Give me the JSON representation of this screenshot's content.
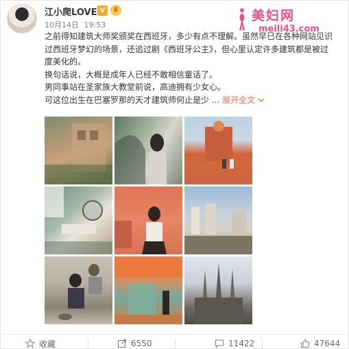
{
  "user": {
    "name": "江小爬LOVE",
    "vip_badge": "V",
    "crown_badge": "♛"
  },
  "post": {
    "date": "10月14日",
    "time": "19:53",
    "lines": [
      "之前得知建筑大师奖颁奖在西班牙，多少有点不理解。虽然早已在各种网站见识",
      "过西班牙梦幻的场景，还追过剧《西班牙公主》，但心里认定许多建筑都是被过",
      "度美化的。",
      "换句话说，大概是成年人已经不敢相信童话了。",
      "男同事站在圣家族大教堂前说，高迪拥有少女心。",
      "可这位出生在巴塞罗那的天才建筑师何止是少"
    ],
    "expand_label": "展开全文",
    "expand_icon": "chevron-down-icon"
  },
  "watermark": {
    "title": "美妇网",
    "url": "meili43.com"
  },
  "images": [
    {
      "name": "photo-1",
      "label": ""
    },
    {
      "name": "photo-2",
      "label": ""
    },
    {
      "name": "photo-3",
      "label": ""
    },
    {
      "name": "photo-4",
      "label": ""
    },
    {
      "name": "photo-5",
      "label": ""
    },
    {
      "name": "photo-6",
      "label": ""
    },
    {
      "name": "photo-7",
      "label": ""
    },
    {
      "name": "photo-8",
      "label": ""
    },
    {
      "name": "photo-9",
      "label": ""
    }
  ],
  "footer": {
    "favorite": {
      "label": "收藏",
      "icon": "star-icon"
    },
    "repost": {
      "count": "6550",
      "icon": "repost-icon"
    },
    "comment": {
      "count": "11422",
      "icon": "comment-icon"
    },
    "like": {
      "count": "47644",
      "icon": "thumbs-up-icon"
    }
  },
  "colors": {
    "accent": "#eb7350",
    "watermark": "#e8508a",
    "text": "#333333",
    "meta": "#808080"
  }
}
